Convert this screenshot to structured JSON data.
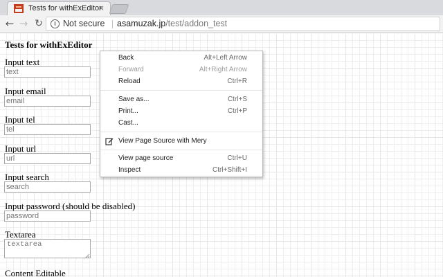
{
  "tab": {
    "title": "Tests for withExEditor",
    "close": "×"
  },
  "nav": {
    "back": "←",
    "forward": "→",
    "reload": "↻"
  },
  "omnibox": {
    "info": "i",
    "security": "Not secure",
    "host": "asamuzak.jp",
    "path": "/test/addon_test"
  },
  "page": {
    "heading": "Tests for withExEditor",
    "fields": [
      {
        "label": "Input text",
        "placeholder": "text"
      },
      {
        "label": "Input email",
        "placeholder": "email"
      },
      {
        "label": "Input tel",
        "placeholder": "tel"
      },
      {
        "label": "Input url",
        "placeholder": "url"
      },
      {
        "label": "Input search",
        "placeholder": "search"
      },
      {
        "label": "Input password (should be disabled)",
        "placeholder": "password"
      }
    ],
    "textarea": {
      "label": "Textarea",
      "placeholder": "textarea"
    },
    "content_editable": {
      "label": "Content Editable"
    }
  },
  "context_menu": {
    "back": {
      "label": "Back",
      "shortcut": "Alt+Left Arrow"
    },
    "forward": {
      "label": "Forward",
      "shortcut": "Alt+Right Arrow"
    },
    "reload": {
      "label": "Reload",
      "shortcut": "Ctrl+R"
    },
    "save_as": {
      "label": "Save as...",
      "shortcut": "Ctrl+S"
    },
    "print": {
      "label": "Print...",
      "shortcut": "Ctrl+P"
    },
    "cast": {
      "label": "Cast..."
    },
    "view_mery": {
      "label": "View Page Source with Mery"
    },
    "view_source": {
      "label": "View page source",
      "shortcut": "Ctrl+U"
    },
    "inspect": {
      "label": "Inspect",
      "shortcut": "Ctrl+Shift+I"
    }
  }
}
